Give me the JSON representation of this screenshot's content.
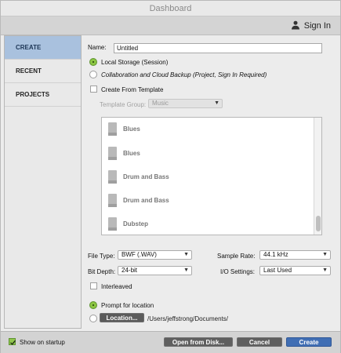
{
  "window": {
    "title": "Dashboard"
  },
  "header": {
    "sign_in_label": "Sign In"
  },
  "sidebar": {
    "items": [
      {
        "label": "CREATE"
      },
      {
        "label": "RECENT"
      },
      {
        "label": "PROJECTS"
      }
    ]
  },
  "form": {
    "name_label": "Name:",
    "name_value": "Untitled",
    "local_storage_label": "Local Storage (Session)",
    "cloud_backup_label": "Collaboration and Cloud Backup (Project, Sign In Required)",
    "create_from_template_label": "Create From Template",
    "template_group_label": "Template Group:",
    "template_group_value": "Music",
    "file_type_label": "File Type:",
    "file_type_value": "BWF (.WAV)",
    "sample_rate_label": "Sample Rate:",
    "sample_rate_value": "44.1 kHz",
    "bit_depth_label": "Bit Depth:",
    "bit_depth_value": "24-bit",
    "io_settings_label": "I/O Settings:",
    "io_settings_value": "Last Used",
    "interleaved_label": "Interleaved",
    "prompt_location_label": "Prompt for location",
    "location_button_label": "Location...",
    "location_path": "/Users/jeffstrong/Documents/"
  },
  "templates": [
    {
      "label": "Blues"
    },
    {
      "label": "Blues"
    },
    {
      "label": "Drum and Bass"
    },
    {
      "label": "Drum and Bass"
    },
    {
      "label": "Dubstep"
    }
  ],
  "footer": {
    "show_on_startup_label": "Show on startup",
    "open_from_disk_label": "Open from Disk...",
    "cancel_label": "Cancel",
    "create_label": "Create"
  },
  "colors": {
    "sidebar_active": "#a9c1de",
    "accent_green": "#8bc542",
    "primary_button": "#406eb4"
  },
  "icons": {
    "sign_in": "person-icon",
    "template": "document-icon",
    "dropdown": "chevron-down-icon",
    "checkmark": "check-icon"
  },
  "state": {
    "storage_selection": "Local Storage (Session)",
    "create_from_template_checked": false,
    "interleaved_checked": false,
    "location_mode": "Prompt for location",
    "show_on_startup_checked": true
  }
}
